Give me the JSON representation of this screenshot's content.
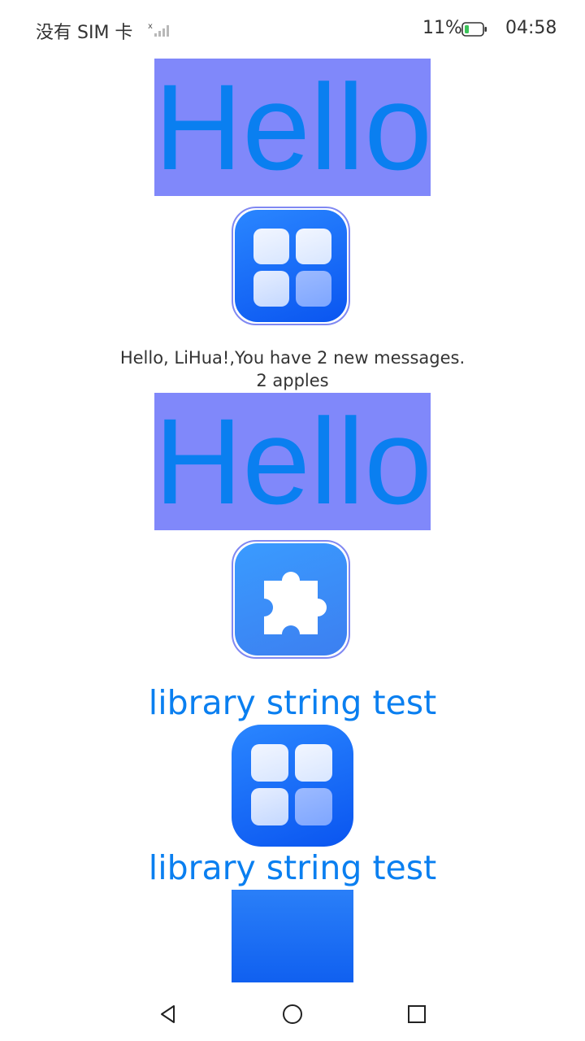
{
  "status_bar": {
    "carrier": "没有 SIM 卡",
    "battery_percent": "11%",
    "time": "04:58",
    "icons": [
      "signal-icon",
      "battery-icon"
    ]
  },
  "content": {
    "hello_1": "Hello",
    "image_1": "app-grid-icon",
    "message": "Hello, LiHua!,You have 2 new messages.",
    "apples": "2 apples",
    "hello_2": "Hello",
    "image_2": "puzzle-piece-icon",
    "library_text_1": "library string test",
    "image_3": "app-grid-icon",
    "library_text_2": "library string test"
  },
  "colors": {
    "hello_bg": "#8088fa",
    "accent_text": "#0a7ff0",
    "icon_border": "#7f88f2",
    "icon_blue": "#0a55f0"
  },
  "nav_bar": {
    "icons": [
      "back-icon",
      "home-icon",
      "recents-icon"
    ]
  }
}
